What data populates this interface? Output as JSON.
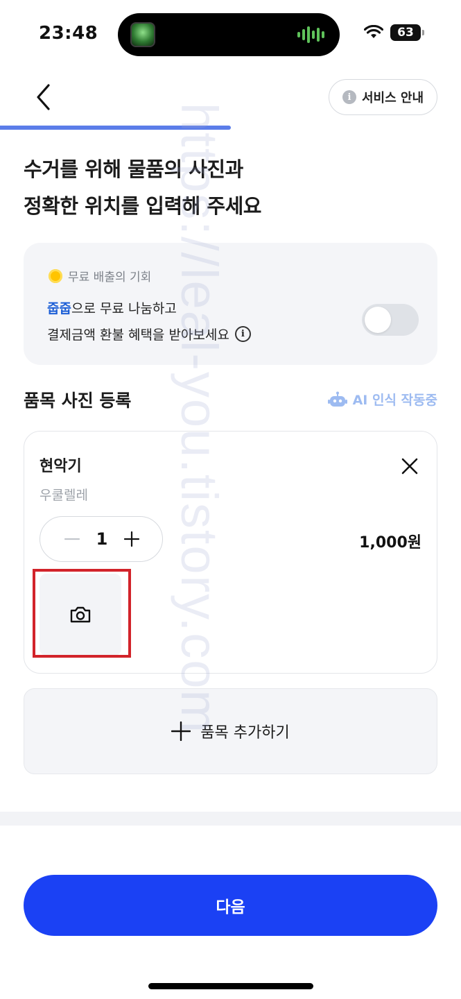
{
  "status_bar": {
    "time": "23:48",
    "battery": "63",
    "icons": [
      "wifi-icon",
      "battery-icon"
    ]
  },
  "header": {
    "back_icon": "chevron-left-icon",
    "service_guide_label": "서비스 안내",
    "progress_fraction": 0.5
  },
  "title": {
    "line1": "수거를 위해 물품의 사진과",
    "line2": "정확한 위치를 입력해 주세요"
  },
  "promo": {
    "tag": "무료 배출의 기회",
    "brand": "줍줍",
    "line1_rest": "으로 무료 나눔하고",
    "line2": "결제금액 환불 혜택을 받아보세요",
    "toggle_on": false
  },
  "section": {
    "title": "품목 사진 등록",
    "ai_status": "AI 인식 작동중"
  },
  "item": {
    "name": "현악기",
    "subcategory": "우쿨렐레",
    "quantity": "1",
    "price": "1,000원"
  },
  "add_item_label": "품목 추가하기",
  "next_label": "다음",
  "watermark": "https://leal-you.tistory.com",
  "colors": {
    "primary": "#1b41f4",
    "progress": "#5b7de9",
    "brand_text": "#1d5fd6",
    "highlight": "#d2232a",
    "ai_text": "#9dbbf1"
  }
}
